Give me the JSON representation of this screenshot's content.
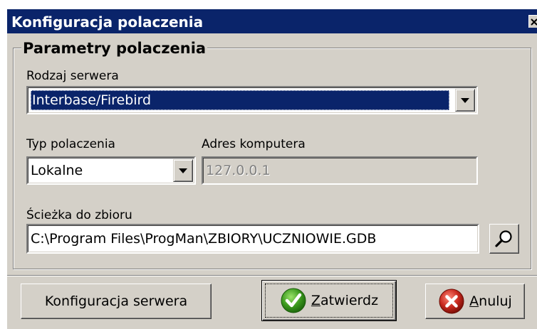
{
  "window": {
    "title": "Konfiguracja polaczenia"
  },
  "group": {
    "legend": "Parametry polaczenia"
  },
  "server_type": {
    "label": "Rodzaj serwera",
    "value": "Interbase/Firebird"
  },
  "connection_type": {
    "label": "Typ polaczenia",
    "value": "Lokalne"
  },
  "computer_address": {
    "label": "Adres komputera",
    "value": "127.0.0.1"
  },
  "file_path": {
    "label": "Ścieżka do zbioru",
    "value": "C:\\Program Files\\ProgMan\\ZBIORY\\UCZNIOWIE.GDB"
  },
  "buttons": {
    "server_config": "Konfiguracja serwera",
    "confirm_first": "Z",
    "confirm_rest": "atwierdz",
    "cancel_first": "A",
    "cancel_rest": "nuluj"
  },
  "colors": {
    "titlebar": "#0a246a",
    "face": "#d4d0c8",
    "confirm_icon": "#3c9a1e",
    "cancel_icon": "#c8281e"
  },
  "icons": {
    "close": "close-icon",
    "dropdown": "chevron-down-icon",
    "browse": "magnifier-icon",
    "confirm": "checkmark-icon",
    "cancel": "cross-icon"
  }
}
